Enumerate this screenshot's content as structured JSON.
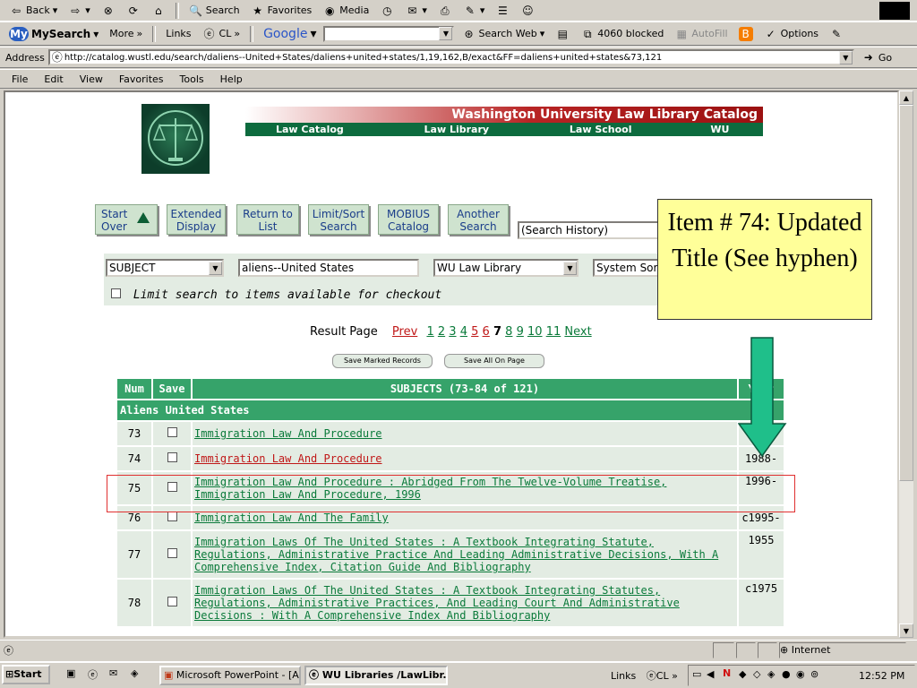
{
  "toolbar": {
    "back": "Back",
    "search": "Search",
    "favorites": "Favorites",
    "media": "Media"
  },
  "toolbar2": {
    "mysearch": "MySearch",
    "more": "More",
    "links": "Links",
    "cl": "CL",
    "google": "Google",
    "search_web": "Search Web",
    "blocked": "4060 blocked",
    "autofill": "AutoFill",
    "options": "Options"
  },
  "address": {
    "label": "Address",
    "url": "http://catalog.wustl.edu/search/daliens--United+States/daliens+united+states/1,19,162,B/exact&FF=daliens+united+states&73,121",
    "go": "Go"
  },
  "menu": [
    "File",
    "Edit",
    "View",
    "Favorites",
    "Tools",
    "Help"
  ],
  "page": {
    "banner_title": "Washington University Law Library Catalog",
    "nav": [
      "Law Catalog Home",
      "Law Library Home",
      "Law School Home",
      "WU Home"
    ],
    "buttons": {
      "start_over": "Start Over",
      "extended": "Extended Display",
      "return": "Return to List",
      "limit": "Limit/Sort Search",
      "mobius": "MOBIUS Catalog",
      "another": "Another Search"
    },
    "history": "(Search History)",
    "search_type": "SUBJECT",
    "search_value": "aliens--United States",
    "library": "WU Law Library",
    "sort": "System Sorted",
    "limit_checkout": "Limit search to items available for checkout",
    "result_page_label": "Result Page",
    "pages": [
      "Prev",
      "1",
      "2",
      "3",
      "4",
      "5",
      "6",
      "7",
      "8",
      "9",
      "10",
      "11",
      "Next"
    ],
    "current_page": "7",
    "save_marked": "Save Marked Records",
    "save_all": "Save All On Page",
    "table": {
      "col_num": "Num",
      "col_save": "Save",
      "col_subjects": "SUBJECTS (73-84 of 121)",
      "col_year": "Year",
      "group": "Aliens United States",
      "rows": [
        {
          "num": "73",
          "title": "Immigration Law And Procedure",
          "year": ""
        },
        {
          "num": "74",
          "title": "Immigration Law And Procedure",
          "year": "1988-"
        },
        {
          "num": "75",
          "title": "Immigration Law And Procedure : Abridged From The Twelve-Volume Treatise, Immigration Law And Procedure, 1996",
          "year": "1996-"
        },
        {
          "num": "76",
          "title": "Immigration Law And The Family",
          "year": "c1995-"
        },
        {
          "num": "77",
          "title": "Immigration Laws Of The United States : A Textbook Integrating Statute, Regulations, Administrative Practice And Leading Administrative Decisions, With A Comprehensive Index, Citation Guide And Bibliography",
          "year": "1955"
        },
        {
          "num": "78",
          "title": "Immigration Laws Of The United States : A Textbook Integrating Statutes, Regulations, Administrative Practices, And Leading Court And Administrative Decisions : With A Comprehensive Index And Bibliography",
          "year": "c1975"
        }
      ]
    }
  },
  "callout": {
    "text": "Item # 74: Updated Title (See hyphen)"
  },
  "status": {
    "zone": "Internet"
  },
  "taskbar": {
    "start": "Start",
    "tasks": [
      "Microsoft PowerPoint - [A...",
      "WU Libraries /LawLibr..."
    ],
    "links": "Links",
    "cl": "CL",
    "time": "12:52 PM"
  },
  "colors": {
    "accent_green": "#36a36a",
    "callout_bg": "#ffff99",
    "arrow": "#1fbf8a",
    "highlight_red": "#e03030"
  }
}
